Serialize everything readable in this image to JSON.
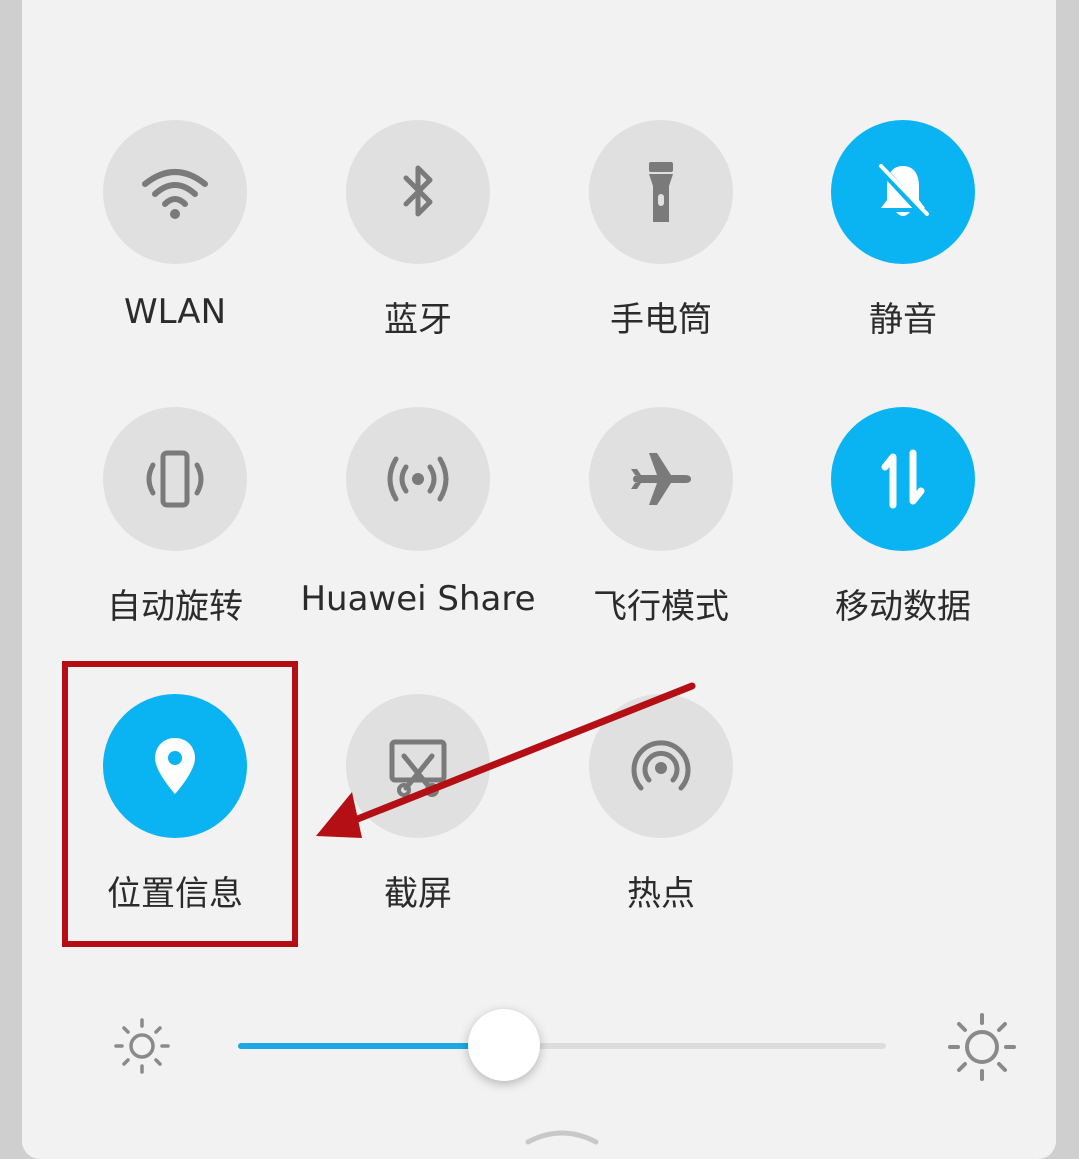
{
  "colors": {
    "active": "#0ab3f2",
    "inactive": "#e0e0e0",
    "icon_inactive": "#7a7a7a",
    "icon_active": "#ffffff",
    "highlight": "#b30f14",
    "slider_fill": "#1ea7e6"
  },
  "tiles": [
    {
      "label": "WLAN",
      "icon": "wifi-icon",
      "active": false
    },
    {
      "label": "蓝牙",
      "icon": "bluetooth-icon",
      "active": false
    },
    {
      "label": "手电筒",
      "icon": "flashlight-icon",
      "active": false
    },
    {
      "label": "静音",
      "icon": "bell-off-icon",
      "active": true
    },
    {
      "label": "自动旋转",
      "icon": "auto-rotate-icon",
      "active": false
    },
    {
      "label": "Huawei Share",
      "icon": "huawei-share-icon",
      "active": false
    },
    {
      "label": "飞行模式",
      "icon": "airplane-icon",
      "active": false
    },
    {
      "label": "移动数据",
      "icon": "mobile-data-icon",
      "active": true
    },
    {
      "label": "位置信息",
      "icon": "location-pin-icon",
      "active": true
    },
    {
      "label": "截屏",
      "icon": "screenshot-icon",
      "active": false
    },
    {
      "label": "热点",
      "icon": "hotspot-icon",
      "active": false
    }
  ],
  "brightness": {
    "level": 0.41,
    "low_icon": "brightness-low-icon",
    "high_icon": "brightness-high-icon"
  },
  "annotation": {
    "highlighted_tile": "位置信息"
  }
}
